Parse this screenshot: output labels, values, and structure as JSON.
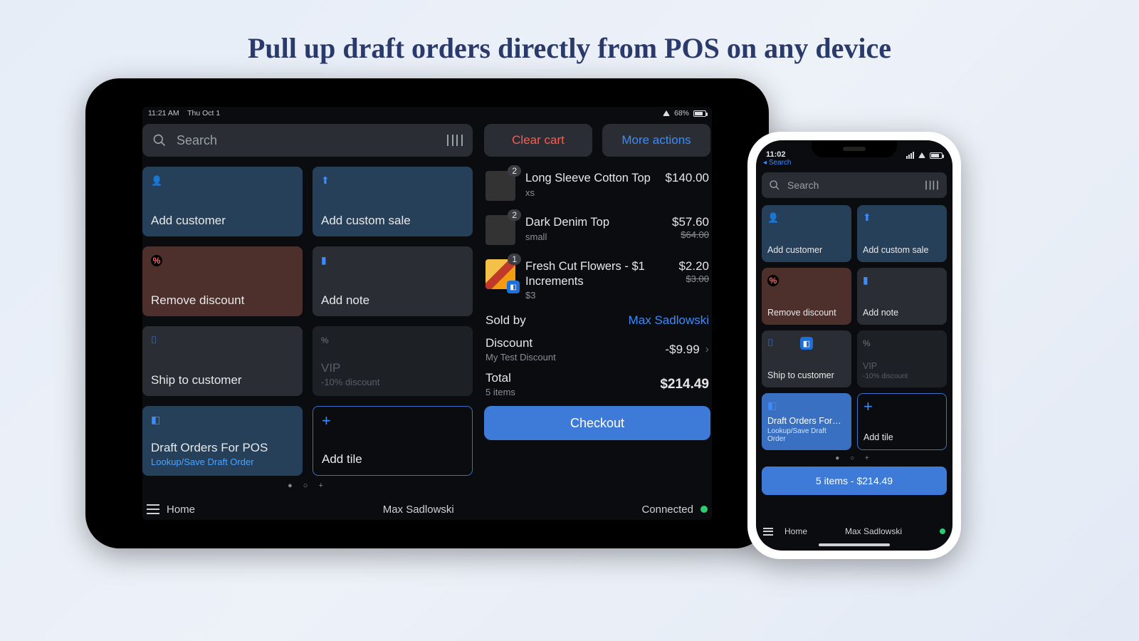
{
  "page": {
    "title": "Pull up draft orders directly from POS on any device"
  },
  "tablet": {
    "status": {
      "time": "11:21 AM",
      "date": "Thu Oct 1",
      "battery_pct": "68%"
    },
    "search": {
      "placeholder": "Search"
    },
    "actions": {
      "clear_cart": "Clear cart",
      "more_actions": "More actions"
    },
    "tiles": {
      "add_customer": {
        "label": "Add customer"
      },
      "add_custom_sale": {
        "label": "Add custom sale"
      },
      "remove_discount": {
        "label": "Remove discount"
      },
      "add_note": {
        "label": "Add note"
      },
      "ship_to_customer": {
        "label": "Ship to customer"
      },
      "vip": {
        "label": "VIP",
        "sub": "-10% discount"
      },
      "draft_orders": {
        "label": "Draft Orders For POS",
        "sub": "Lookup/Save Draft Order"
      },
      "add_tile": {
        "label": "Add tile"
      }
    },
    "cart": {
      "items": [
        {
          "qty": "2",
          "name": "Long Sleeve Cotton Top",
          "variant": "xs",
          "price": "$140.00",
          "original": ""
        },
        {
          "qty": "2",
          "name": "Dark Denim Top",
          "variant": "small",
          "price": "$57.60",
          "original": "$64.00"
        },
        {
          "qty": "1",
          "name": "Fresh Cut Flowers - $1 Increments",
          "variant": "$3",
          "price": "$2.20",
          "original": "$3.00"
        }
      ],
      "sold_by": {
        "label": "Sold by",
        "value": "Max Sadlowski"
      },
      "discount": {
        "label": "Discount",
        "sub": "My Test Discount",
        "value": "-$9.99"
      },
      "total": {
        "label": "Total",
        "sub": "5 items",
        "value": "$214.49"
      },
      "checkout": "Checkout"
    },
    "bottom": {
      "home": "Home",
      "user": "Max Sadlowski",
      "connected": "Connected"
    }
  },
  "phone": {
    "status": {
      "time": "11:02"
    },
    "back_hint": "Search",
    "search": {
      "placeholder": "Search"
    },
    "tiles": {
      "add_customer": {
        "label": "Add customer"
      },
      "add_custom_sale": {
        "label": "Add custom sale"
      },
      "remove_discount": {
        "label": "Remove discount"
      },
      "add_note": {
        "label": "Add note"
      },
      "ship_to_customer": {
        "label": "Ship to customer"
      },
      "vip": {
        "label": "VIP",
        "sub": "-10% discount"
      },
      "draft_orders": {
        "label": "Draft Orders For…",
        "sub": "Lookup/Save Draft Order"
      },
      "add_tile": {
        "label": "Add tile"
      }
    },
    "checkout": "5 items - $214.49",
    "bottom": {
      "home": "Home",
      "user": "Max Sadlowski"
    }
  }
}
